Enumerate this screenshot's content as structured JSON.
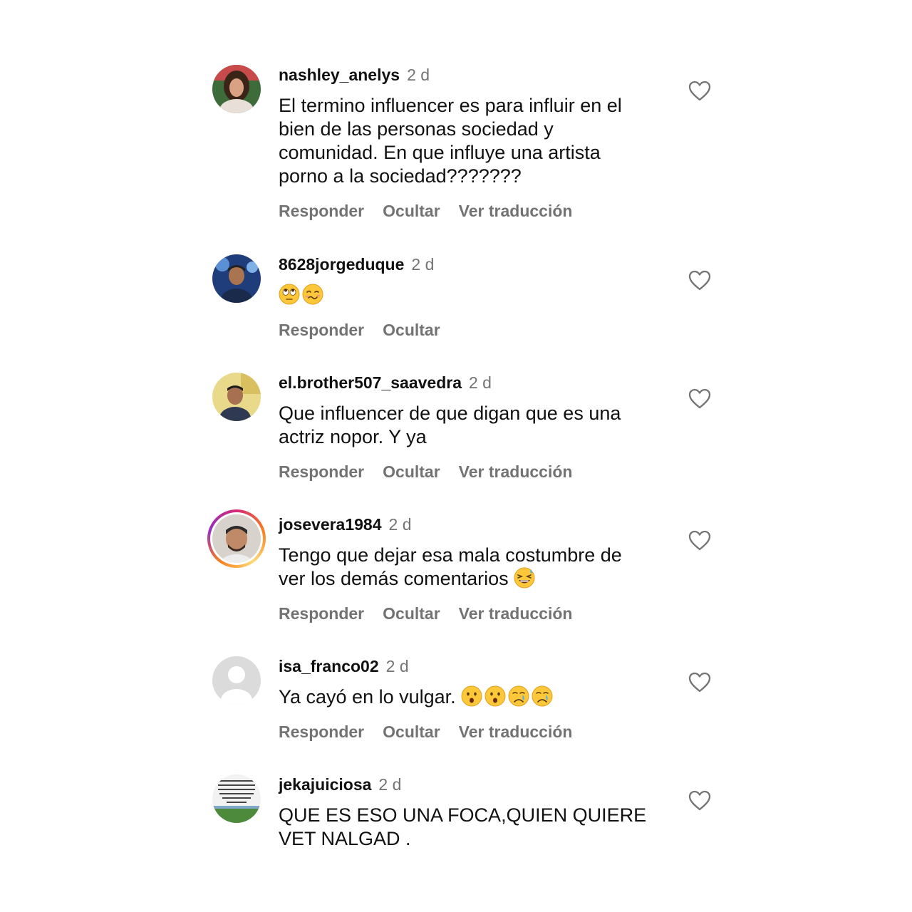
{
  "comments": [
    {
      "username": "nashley_anelys",
      "time": "2 d",
      "text": "El termino influencer es para influir en el bien de las personas sociedad y comunidad. En que influye una artista porno a la sociedad???????",
      "actions": [
        "Responder",
        "Ocultar",
        "Ver traducción"
      ]
    },
    {
      "username": "8628jorgeduque",
      "time": "2 d",
      "text": "",
      "emojis": [
        "face-with-rolling-eyes",
        "woozy-face"
      ],
      "actions": [
        "Responder",
        "Ocultar"
      ]
    },
    {
      "username": "el.brother507_saavedra",
      "time": "2 d",
      "text": "Que influencer de que digan que es una actriz nopor. Y ya",
      "actions": [
        "Responder",
        "Ocultar",
        "Ver traducción"
      ]
    },
    {
      "username": "josevera1984",
      "time": "2 d",
      "text": "Tengo que dejar esa mala costumbre de ver los demás comentarios",
      "emojis": [
        "grinning-squinting-face-with-sweat"
      ],
      "actions": [
        "Responder",
        "Ocultar",
        "Ver traducción"
      ]
    },
    {
      "username": "isa_franco02",
      "time": "2 d",
      "text": "Ya cayó en lo vulgar.",
      "emojis": [
        "hushed-face",
        "hushed-face",
        "crying-face",
        "crying-face"
      ],
      "actions": [
        "Responder",
        "Ocultar",
        "Ver traducción"
      ]
    },
    {
      "username": "jekajuiciosa",
      "time": "2 d",
      "text": "QUE ES ESO UNA FOCA,QUIEN QUIERE VET NALGAD .",
      "actions": []
    }
  ],
  "colors": {
    "text": "#111111",
    "secondary": "#737373",
    "story_ring": "#d62976"
  },
  "icons": [
    "heart-outline-icon"
  ]
}
